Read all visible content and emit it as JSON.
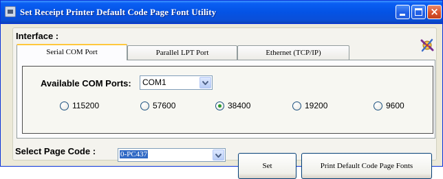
{
  "window": {
    "title": "Set Receipt Printer Default Code Page Font Utility",
    "controls": {
      "close_glyph": "×"
    }
  },
  "interface": {
    "label": "Interface :",
    "tabs": [
      {
        "label": "Serial COM Port",
        "selected": true
      },
      {
        "label": "Parallel LPT Port",
        "selected": false
      },
      {
        "label": "Ethernet (TCP/IP)",
        "selected": false
      }
    ]
  },
  "serial": {
    "ports_label": "Available COM Ports:",
    "port_selected": "COM1",
    "baud_rates": [
      {
        "label": "115200",
        "checked": false
      },
      {
        "label": "57600",
        "checked": false
      },
      {
        "label": "38400",
        "checked": true
      },
      {
        "label": "19200",
        "checked": false
      },
      {
        "label": "9600",
        "checked": false
      }
    ]
  },
  "page_code": {
    "label": "Select Page Code :",
    "selected": "0-PC437"
  },
  "buttons": {
    "set": "Set",
    "print": "Print Default Code Page Fonts"
  },
  "colors": {
    "title_bar": "#0453e5",
    "radio_checked": "#2b9a2b",
    "selection_highlight": "#316ac5"
  },
  "icons": {
    "app": "printer-app-icon",
    "tools": "tools-icon"
  }
}
